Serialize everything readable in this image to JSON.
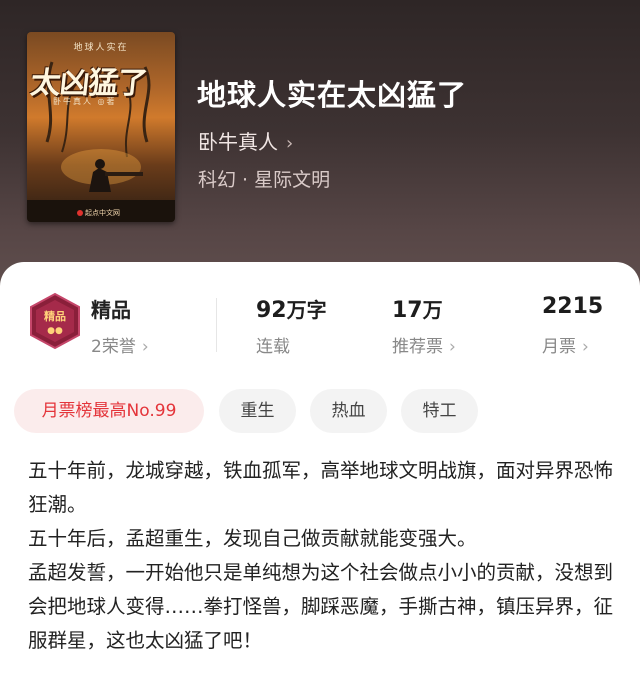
{
  "book": {
    "title": "地球人实在太凶猛了",
    "author": "卧牛真人",
    "author_chevron": "›",
    "genre": "科幻 · 星际文明"
  },
  "cover": {
    "small_title": "地球人实在",
    "big_title": "太凶猛了",
    "author_line": "卧牛真人 ◎著",
    "publisher": "起点中文网"
  },
  "stats": {
    "quality": "精品",
    "honor": "2荣誉",
    "words_value": "92",
    "words_unit": "万字",
    "words_label": "连载",
    "recommend_value": "17",
    "recommend_unit": "万",
    "recommend_label": "推荐票",
    "monthly_value": "2215",
    "monthly_label": "月票",
    "chevron": "›"
  },
  "tags": [
    "月票榜最高No.99",
    "重生",
    "热血",
    "特工"
  ],
  "description": [
    "五十年前，龙城穿越，铁血孤军，高举地球文明战旗，面对异界恐怖狂潮。",
    "五十年后，孟超重生，发现自己做贡献就能变强大。",
    "孟超发誓，一开始他只是单纯想为这个社会做点小小的贡献，没想到会把地球人变得……拳打怪兽，脚踩恶魔，手撕古神，镇压异界，征服群星，这也太凶猛了吧！"
  ],
  "colors": {
    "header_top": "#2e2626",
    "header_bottom": "#604f4e",
    "rank_tag_text": "#e4343a",
    "rank_tag_bg": "#fbecec"
  }
}
